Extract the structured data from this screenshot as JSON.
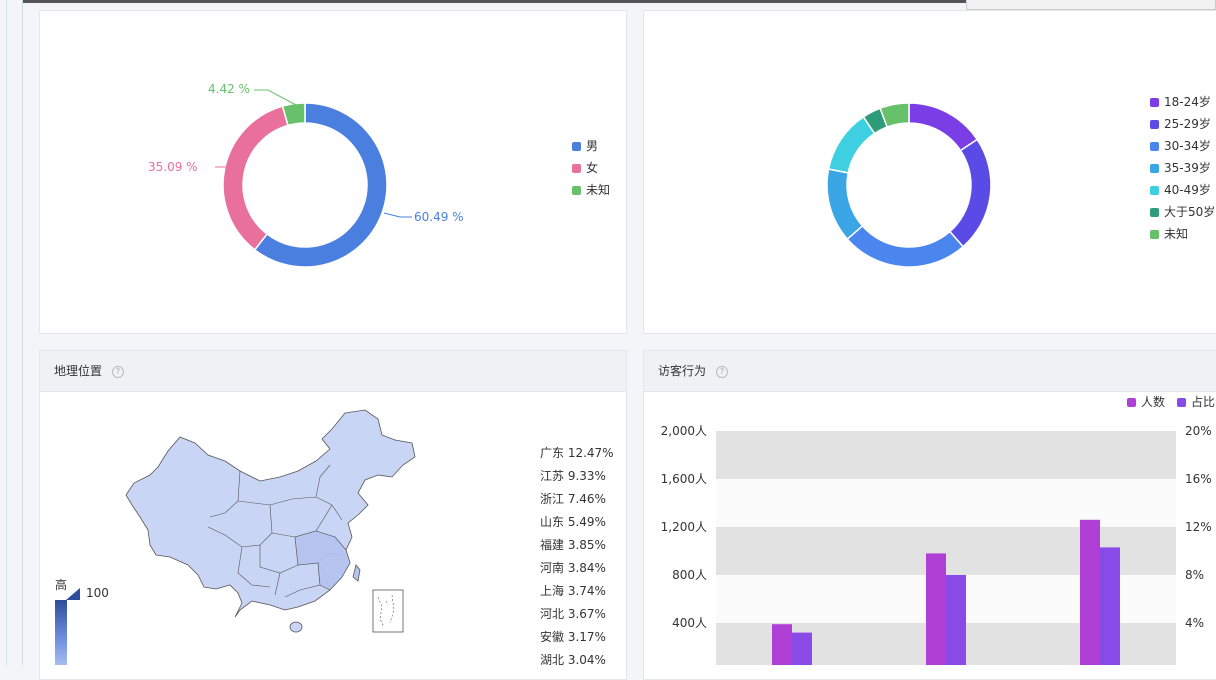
{
  "gender": {
    "legend": [
      {
        "label": "男",
        "color": "#4a7fe0"
      },
      {
        "label": "女",
        "color": "#e8709a"
      },
      {
        "label": "未知",
        "color": "#67c06a"
      }
    ],
    "labels": {
      "male": "60.49 %",
      "female": "35.09 %",
      "unknown": "4.42 %"
    }
  },
  "age": {
    "legend": [
      {
        "label": "18-24岁",
        "color": "#7a3de6"
      },
      {
        "label": "25-29岁",
        "color": "#5a4be6"
      },
      {
        "label": "30-34岁",
        "color": "#4a86ee"
      },
      {
        "label": "35-39岁",
        "color": "#3aa6e6"
      },
      {
        "label": "40-49岁",
        "color": "#3ed0e0"
      },
      {
        "label": "大于50岁",
        "color": "#2e9c78"
      },
      {
        "label": "未知",
        "color": "#67c06a"
      }
    ]
  },
  "geo": {
    "title": "地理位置",
    "help_icon": "help-circle-icon",
    "scale": {
      "high_label": "高",
      "max": "100"
    },
    "regions": [
      "广东 12.47%",
      "江苏 9.33%",
      "浙江 7.46%",
      "山东 5.49%",
      "福建 3.85%",
      "河南 3.84%",
      "上海 3.74%",
      "河北 3.67%",
      "安徽 3.17%",
      "湖北 3.04%"
    ]
  },
  "visitor": {
    "title": "访客行为",
    "help_icon": "help-circle-icon",
    "legend": [
      {
        "label": "人数",
        "color": "#b03fd6"
      },
      {
        "label": "占比",
        "color": "#8a4ae8"
      }
    ]
  },
  "chart_data": [
    {
      "type": "pie",
      "labels": [
        "男",
        "女",
        "未知"
      ],
      "values": [
        60.49,
        35.09,
        4.42
      ],
      "colors": [
        "#4a7fe0",
        "#e8709a",
        "#67c06a"
      ],
      "legend": "right"
    },
    {
      "type": "pie",
      "labels": [
        "18-24岁",
        "25-29岁",
        "30-34岁",
        "35-39岁",
        "40-49岁",
        "大于50岁",
        "未知"
      ],
      "values": [
        15,
        22,
        24,
        14,
        12,
        3.5,
        5.5
      ],
      "colors": [
        "#7a3de6",
        "#5a4be6",
        "#4a86ee",
        "#3aa6e6",
        "#3ed0e0",
        "#2e9c78",
        "#67c06a"
      ],
      "legend": "right"
    },
    {
      "type": "bar",
      "series": [
        {
          "name": "人数",
          "values": [
            390,
            980,
            1260
          ],
          "color": "#b03fd6"
        },
        {
          "name": "占比",
          "values": [
            3.2,
            8.0,
            10.3
          ],
          "color": "#8a4ae8"
        }
      ],
      "y_ticks": [
        "400人",
        "800人",
        "1,200人",
        "1,600人",
        "2,000人"
      ],
      "y2_ticks": [
        "4%",
        "8%",
        "12%",
        "16%",
        "20%"
      ],
      "ylim": [
        0,
        2000
      ],
      "y2lim": [
        0,
        20
      ],
      "grid": true,
      "legend": "top-right"
    }
  ]
}
